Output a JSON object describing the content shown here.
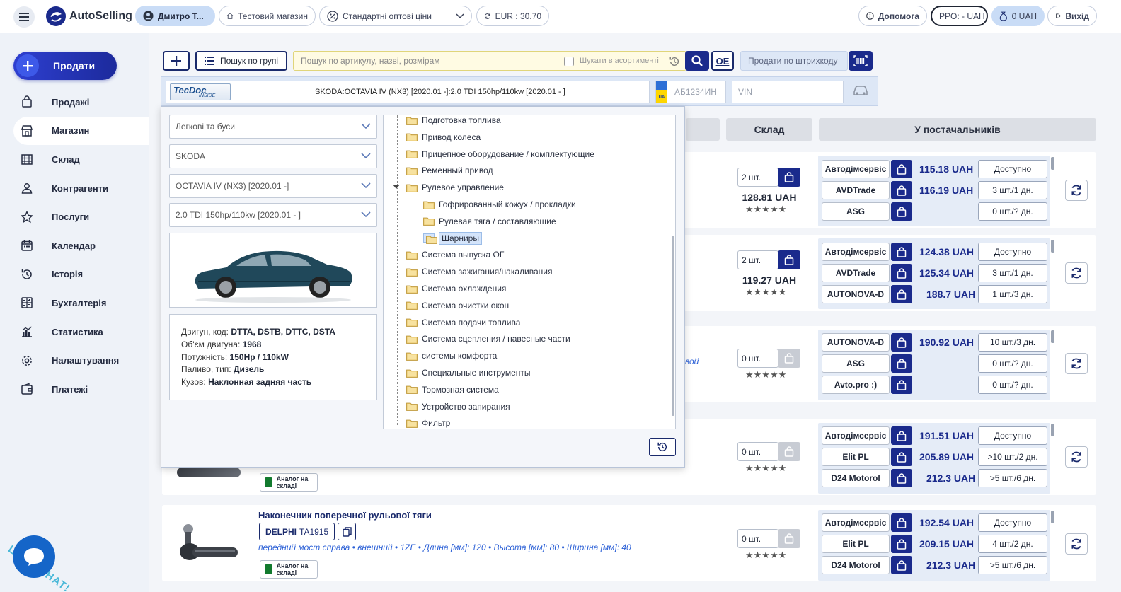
{
  "app": {
    "name": "AutoSelling"
  },
  "header": {
    "user": "Дмитро Т...",
    "shop": "Тестовий магазин",
    "price_type": "Стандартні оптові ціни",
    "currency": "EUR : 30.70",
    "help": "Допомога",
    "rro": "PPO: - UAH",
    "balance": "0 UAH",
    "exit": "Вихід"
  },
  "sidebar": {
    "sell_label": "Продати",
    "items": [
      {
        "label": "Продажі",
        "icon": "bag-icon"
      },
      {
        "label": "Магазин",
        "icon": "store-icon"
      },
      {
        "label": "Склад",
        "icon": "warehouse-icon"
      },
      {
        "label": "Контрагенти",
        "icon": "users-icon"
      },
      {
        "label": "Послуги",
        "icon": "star-icon"
      },
      {
        "label": "Календар",
        "icon": "calendar-icon"
      },
      {
        "label": "Історія",
        "icon": "history-icon"
      },
      {
        "label": "Бухгалтерія",
        "icon": "calculator-icon"
      },
      {
        "label": "Статистика",
        "icon": "chart-icon"
      },
      {
        "label": "Налаштування",
        "icon": "gear-icon"
      },
      {
        "label": "Платежі",
        "icon": "wallet-icon"
      }
    ],
    "chat_label": "LET'S CHAT!"
  },
  "toolbar": {
    "group_search_label": "Пошук по групі",
    "search_placeholder": "Пошук по артикулу, назві, розмірам",
    "in_assortment_label": "Шукати в асортименті",
    "oe_label": "OE",
    "barcode_placeholder": "Продати по штрихкоду"
  },
  "carbar": {
    "tecdoc": "TecDoc",
    "tecdoc_sub": "INSIDE",
    "car": "SKODA:OCTAVIA IV (NX3) [2020.01 -]:2.0 TDI 150hp/110kw [2020.01 - ]",
    "plate_country": "UA",
    "plate_placeholder": "АБ1234ИН",
    "vin_placeholder": "VIN"
  },
  "columns": {
    "stock": "Склад",
    "suppliers": "У постачальників"
  },
  "selector": {
    "vehicle_type": "Легкові та буси",
    "make": "SKODA",
    "model": "OCTAVIA IV (NX3) [2020.01 -]",
    "engine": "2.0 TDI 150hp/110kw [2020.01 - ]",
    "specs": [
      {
        "label": "Двигун, код:",
        "value": "DTTA, DSTB, DTTC, DSTA"
      },
      {
        "label": "Об'єм двигуна:",
        "value": "1968"
      },
      {
        "label": "Потужність:",
        "value": "150Hp / 110kW"
      },
      {
        "label": "Паливо, тип:",
        "value": "Дизель"
      },
      {
        "label": "Кузов:",
        "value": "Наклонная задняя часть"
      }
    ]
  },
  "tree": [
    {
      "label": "Подготовка топлива",
      "level": 0
    },
    {
      "label": "Привод колеса",
      "level": 0
    },
    {
      "label": "Прицепное оборудование / комплектующие",
      "level": 0
    },
    {
      "label": "Ременный привод",
      "level": 0
    },
    {
      "label": "Рулевое управление",
      "level": 0,
      "expanded": true
    },
    {
      "label": "Гофрированный кожух / прокладки",
      "level": 1
    },
    {
      "label": "Рулевая тяга / составляющие",
      "level": 1
    },
    {
      "label": "Шарниры",
      "level": 1,
      "selected": true
    },
    {
      "label": "Система выпуска ОГ",
      "level": 0
    },
    {
      "label": "Система зажигания/накаливания",
      "level": 0
    },
    {
      "label": "Система охлаждения",
      "level": 0
    },
    {
      "label": "Система очистки окон",
      "level": 0
    },
    {
      "label": "Система подачи топлива",
      "level": 0
    },
    {
      "label": "Система сцепления / навесные части",
      "level": 0
    },
    {
      "label": "системы комфорта",
      "level": 0
    },
    {
      "label": "Специальные инструменты",
      "level": 0
    },
    {
      "label": "Тормозная система",
      "level": 0
    },
    {
      "label": "Устройство запирания",
      "level": 0
    },
    {
      "label": "Фильтр",
      "level": 0
    }
  ],
  "products": [
    {
      "qty": "2 шт.",
      "price": "128.81 UAH",
      "in_stock": true,
      "suppliers": [
        {
          "name": "Автодімсервіс",
          "price": "115.18 UAH",
          "avail": "Доступно"
        },
        {
          "name": "AVDTrade",
          "price": "116.19 UAH",
          "avail": "3 шт./1 дн."
        },
        {
          "name": "ASG",
          "price": "",
          "avail": "0 шт./? дн."
        }
      ]
    },
    {
      "qty": "2 шт.",
      "price": "119.27 UAH",
      "in_stock": true,
      "suppliers": [
        {
          "name": "Автодімсервіс",
          "price": "124.38 UAH",
          "avail": "Доступно"
        },
        {
          "name": "AVDTrade",
          "price": "125.34 UAH",
          "avail": "3 шт./1 дн."
        },
        {
          "name": "AUTONOVA-D",
          "price": "188.7 UAH",
          "avail": "1 шт./3 дн."
        }
      ]
    },
    {
      "qty": "0 шт.",
      "price": "",
      "in_stock": false,
      "desc_fragment": "вой",
      "suppliers": [
        {
          "name": "AUTONOVA-D",
          "price": "190.92 UAH",
          "avail": "10 шт./3 дн."
        },
        {
          "name": "ASG",
          "price": "",
          "avail": "0 шт./? дн."
        },
        {
          "name": "Avto.pro :)",
          "price": "",
          "avail": "0 шт./? дн."
        }
      ]
    },
    {
      "qty": "0 шт.",
      "price": "",
      "in_stock": false,
      "analog": "Аналог на складі",
      "suppliers": [
        {
          "name": "Автодімсервіс",
          "price": "191.51 UAH",
          "avail": "Доступно"
        },
        {
          "name": "Elit PL",
          "price": "205.89 UAH",
          "avail": ">10 шт./2 дн."
        },
        {
          "name": "D24 Motorol",
          "price": "212.3 UAH",
          "avail": ">5 шт./6 дн."
        }
      ]
    },
    {
      "qty": "0 шт.",
      "price": "",
      "in_stock": false,
      "title": "Наконечник поперечної рульової тяги",
      "brand": "DELPHI",
      "article": "TA1915",
      "description": "передний мост справа • внешний • 1ZE • Длина [мм]: 120 • Высота [мм]: 80 • Ширина [мм]: 40",
      "analog": "Аналог на складі",
      "suppliers": [
        {
          "name": "Автодімсервіс",
          "price": "192.54 UAH",
          "avail": "Доступно"
        },
        {
          "name": "Elit PL",
          "price": "209.15 UAH",
          "avail": "4 шт./2 дн."
        },
        {
          "name": "D24 Motorol",
          "price": "212.3 UAH",
          "avail": ">5 шт./6 дн."
        }
      ]
    }
  ],
  "stars": "★★★★★",
  "colors": {
    "primary": "#1a2a8c",
    "accent": "#2e3fd0",
    "highlight": "#fffbe3"
  }
}
